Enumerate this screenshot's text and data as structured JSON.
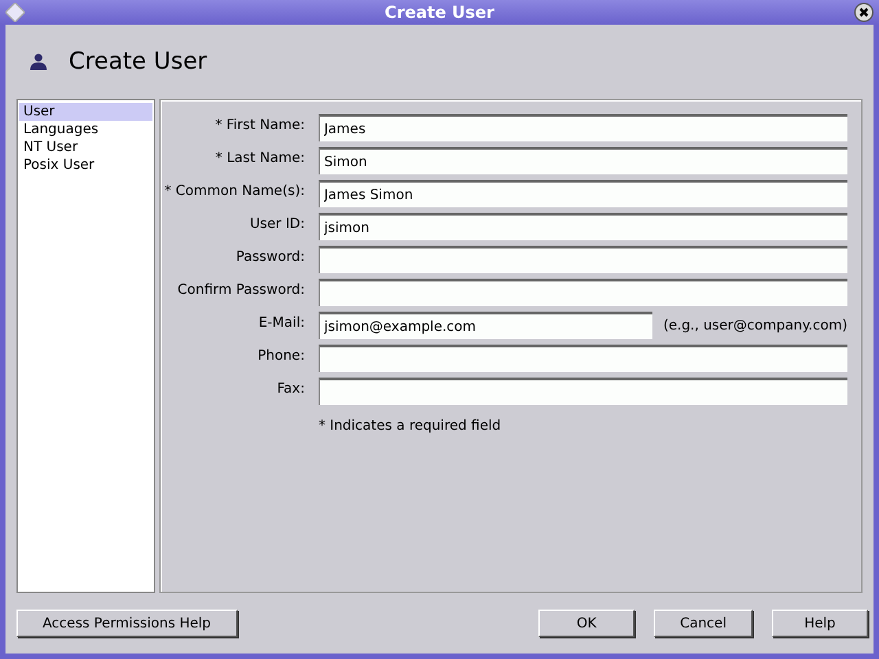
{
  "window": {
    "title": "Create User"
  },
  "header": {
    "title": "Create User"
  },
  "sidebar": {
    "items": [
      {
        "label": "User",
        "selected": true
      },
      {
        "label": "Languages",
        "selected": false
      },
      {
        "label": "NT User",
        "selected": false
      },
      {
        "label": "Posix User",
        "selected": false
      }
    ]
  },
  "form": {
    "fields": [
      {
        "label": "* First Name:",
        "value": "James"
      },
      {
        "label": "* Last Name:",
        "value": "Simon"
      },
      {
        "label": "* Common Name(s):",
        "value": "James Simon"
      },
      {
        "label": "User ID:",
        "value": "jsimon"
      },
      {
        "label": "Password:"
      },
      {
        "label": "Confirm Password:"
      },
      {
        "label": "E-Mail:",
        "value": "jsimon@example.com",
        "hint": "(e.g., user@company.com)"
      },
      {
        "label": "Phone:"
      },
      {
        "label": "Fax:"
      }
    ],
    "note": "* Indicates a required field"
  },
  "buttons_left": [
    "Access Permissions Help"
  ],
  "buttons_right": [
    "OK",
    "Cancel",
    "Help"
  ]
}
